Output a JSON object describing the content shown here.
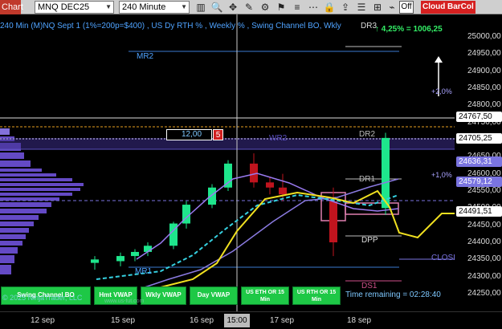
{
  "toolbar": {
    "chart_label": "Chart",
    "instrument": "MNQ DEC25",
    "interval": "240 Minute",
    "toggle_off": "Off",
    "cloud_label": "Cloud",
    "barcol_label": "BarCol"
  },
  "header": {
    "title": "240 Min (M)NQ Sept 1 (1%=200p=$400) , US Dy RTH % , Weekly % , Swing Channel BO, Wkly",
    "pct_change": "↑ 4,25% = 1006,25"
  },
  "y_axis": {
    "ticks": [
      "25000,00",
      "24950,00",
      "24900,00",
      "24850,00",
      "24800,00",
      "24750,00",
      "24700,00",
      "24650,00",
      "24600,00",
      "24550,00",
      "24500,00",
      "24450,00",
      "24400,00",
      "24350,00",
      "24300,00",
      "24250,00"
    ]
  },
  "price_boxes": [
    {
      "value": "24767,50",
      "bg": "#ffffff",
      "fg": "#000000"
    },
    {
      "value": "24705,25",
      "bg": "#ffffff",
      "fg": "#000000"
    },
    {
      "value": "24636,31",
      "bg": "#7a74e0",
      "fg": "#ffffff"
    },
    {
      "value": "24579,12",
      "bg": "#7a74e0",
      "fg": "#ffffff"
    },
    {
      "value": "24491,51",
      "bg": "#ffffff",
      "fg": "#000000"
    }
  ],
  "x_axis": {
    "labels": [
      "12 sep",
      "15 sep",
      "16 sep",
      "17 sep",
      "18 sep"
    ],
    "cursor_label": "15:00"
  },
  "levels": {
    "mr2": "MR2",
    "mr1": "MR1",
    "wr2": "WR2",
    "dr3": "DR3",
    "dr2": "DR2",
    "dr1": "DR1",
    "dpp": "DPP",
    "ds1": "DS1",
    "close": "CLOSE",
    "plus2": "+2,0%",
    "plus1": "+1,0%",
    "minus1_label": ""
  },
  "order_pill": {
    "qty": "12,00",
    "count": "5"
  },
  "buttons": [
    {
      "label": "Swing Channel BO"
    },
    {
      "label": "Hmt VWAP"
    },
    {
      "label": "Wkly VWAP"
    },
    {
      "label": "Day VWAP"
    },
    {
      "label": "US ETH OR 15 Min"
    },
    {
      "label": "US RTH OR 15 Min"
    }
  ],
  "time_remaining": "Time remaining = 02:28:40",
  "copyright": "© 2025 NinjaTrader, LLC",
  "watermark": "www.us-fut.com",
  "colors": {
    "up_candle": "#1ee68c",
    "down_candle": "#c0141e",
    "vwap_day": "#f0e020",
    "vwap_wkly": "#8a7ae0",
    "vwap_hmt": "#35d0e0",
    "profile": "#6a4fd0"
  },
  "chart_data": {
    "type": "candlestick",
    "x": [
      "12 sep",
      "",
      "15 sep",
      "",
      "",
      "16 sep",
      "",
      "",
      "17 sep",
      "",
      "",
      "18 sep",
      ""
    ],
    "candles": [
      {
        "o": 24340,
        "h": 24360,
        "l": 24320,
        "c": 24350
      },
      {
        "o": 24345,
        "h": 24370,
        "l": 24330,
        "c": 24360
      },
      {
        "o": 24360,
        "h": 24380,
        "l": 24345,
        "c": 24372
      },
      {
        "o": 24372,
        "h": 24400,
        "l": 24360,
        "c": 24390
      },
      {
        "o": 24390,
        "h": 24460,
        "l": 24380,
        "c": 24455
      },
      {
        "o": 24455,
        "h": 24520,
        "l": 24440,
        "c": 24510
      },
      {
        "o": 24510,
        "h": 24570,
        "l": 24500,
        "c": 24560
      },
      {
        "o": 24560,
        "h": 24640,
        "l": 24550,
        "c": 24630
      },
      {
        "o": 24630,
        "h": 24660,
        "l": 24560,
        "c": 24575
      },
      {
        "o": 24575,
        "h": 24590,
        "l": 24540,
        "c": 24560
      },
      {
        "o": 24560,
        "h": 24600,
        "l": 24520,
        "c": 24540
      },
      {
        "o": 24520,
        "h": 24560,
        "l": 24360,
        "c": 24400
      },
      {
        "o": 24500,
        "h": 24720,
        "l": 24480,
        "c": 24705
      }
    ]
  }
}
